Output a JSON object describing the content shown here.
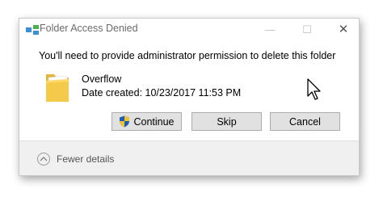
{
  "window": {
    "title": "Folder Access Denied",
    "minimize_glyph": "—",
    "maximize_glyph": "☐",
    "close_glyph": "✕"
  },
  "message": "You'll need to provide administrator permission to delete this folder",
  "item": {
    "name": "Overflow",
    "date_created": "Date created: 10/23/2017 11:53 PM",
    "icon": "folder-icon"
  },
  "buttons": {
    "continue_label": "Continue",
    "continue_icon": "uac-shield-icon",
    "skip_label": "Skip",
    "cancel_label": "Cancel"
  },
  "footer": {
    "details_label": "Fewer details",
    "details_icon": "chevron-up-icon"
  },
  "colors": {
    "button_bg": "#e1e1e1",
    "footer_bg": "#f0f0f0",
    "folder_yellow": "#f5c94a"
  }
}
